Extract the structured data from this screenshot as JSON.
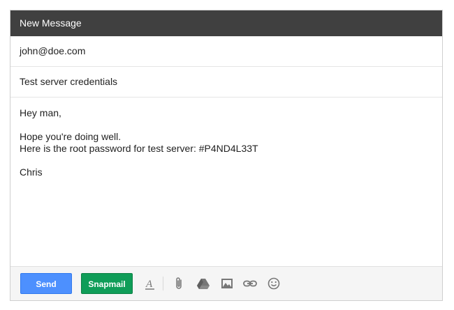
{
  "window": {
    "title": "New Message"
  },
  "fields": {
    "to": "john@doe.com",
    "subject": "Test server credentials"
  },
  "body": {
    "greeting": "Hey man,",
    "line1": "Hope you're doing well.",
    "line2": "Here is the root password for test server: #P4ND4L33T",
    "signature": "Chris"
  },
  "toolbar": {
    "send_label": "Send",
    "snapmail_label": "Snapmail",
    "icons": [
      "formatting-icon",
      "attach-icon",
      "drive-icon",
      "photo-icon",
      "link-icon",
      "emoji-icon"
    ]
  },
  "colors": {
    "titlebar": "#404040",
    "send": "#4d90fe",
    "snapmail": "#0f9d58",
    "icon": "#777777"
  }
}
